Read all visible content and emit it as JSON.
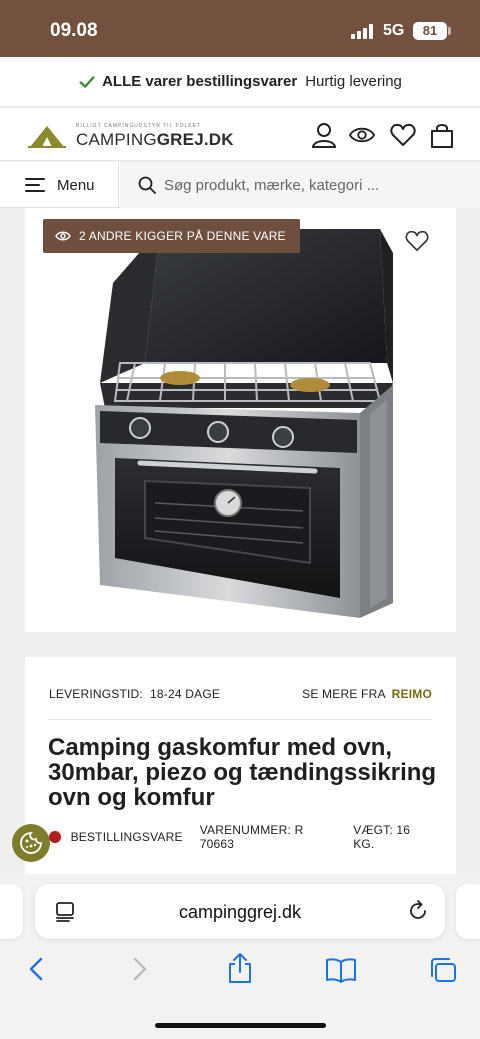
{
  "status": {
    "time": "09.08",
    "network": "5G",
    "battery": "81"
  },
  "promo": {
    "bold": "ALLE varer bestillingsvarer",
    "text": "Hurtig levering"
  },
  "header": {
    "logo_tagline": "BILLIGT CAMPINGUDSTYR TIL FOLKET",
    "logo_light": "CAMPING",
    "logo_bold": "GREJ.DK"
  },
  "nav": {
    "menu_label": "Menu",
    "search_placeholder": "Søg produkt, mærke, kategori ..."
  },
  "product": {
    "viewers": "2 ANDRE KIGGER PÅ DENNE VARE",
    "delivery_label": "LEVERINGSTID:",
    "delivery_value": "18-24 DAGE",
    "see_more": "SE MERE FRA",
    "brand": "REIMO",
    "title": "Camping gaskomfur med ovn, 30mbar, piezo og tændingssikring ovn og komfur",
    "stock": "BESTILLINGSVARE",
    "sku": "VARENUMMER: R 70663",
    "weight": "VÆGT: 16 KG."
  },
  "browser": {
    "url": "campinggrej.dk"
  },
  "colors": {
    "brand_brown": "#6e4f3d",
    "brand_olive": "#7b6a12",
    "stock_red": "#b21d1d",
    "check_green": "#3e8a2c"
  }
}
